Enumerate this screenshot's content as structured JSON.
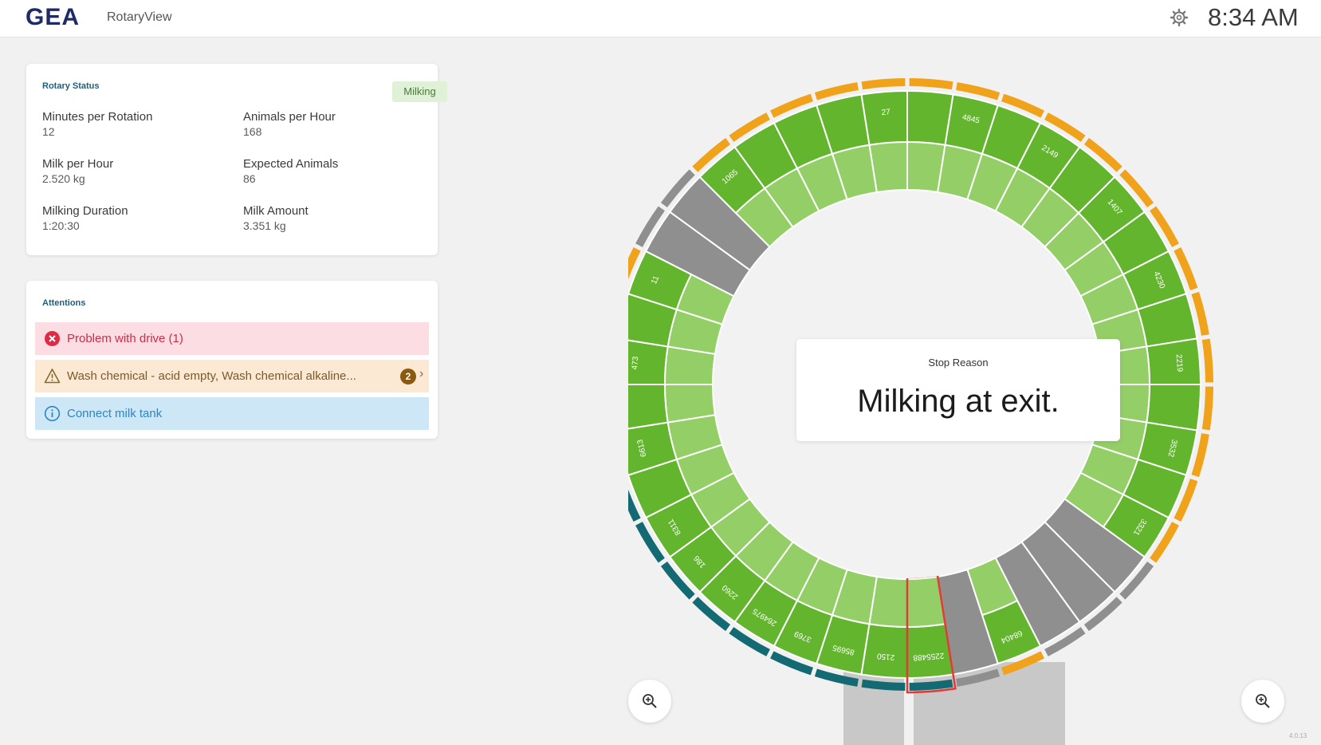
{
  "header": {
    "logo": "GEA",
    "app_name": "RotaryView",
    "settings_icon": "gear-icon",
    "time": "8:34 AM"
  },
  "rotary_status": {
    "title": "Rotary Status",
    "state": "Milking",
    "stats": [
      {
        "label": "Minutes per Rotation",
        "value": "12"
      },
      {
        "label": "Animals per Hour",
        "value": "168"
      },
      {
        "label": "Milk per Hour",
        "value": "2.520 kg"
      },
      {
        "label": "Expected Animals",
        "value": "86"
      },
      {
        "label": "Milking Duration",
        "value": "1:20:30"
      },
      {
        "label": "Milk Amount",
        "value": "3.351 kg"
      }
    ]
  },
  "attentions": {
    "title": "Attentions",
    "items": [
      {
        "type": "error",
        "icon": "error-circle-icon",
        "text": "Problem with drive (1)"
      },
      {
        "type": "warning",
        "icon": "warning-triangle-icon",
        "text": "Wash chemical - acid empty, Wash chemical alkaline...",
        "count": "2",
        "chevron": "chevron-right-icon"
      },
      {
        "type": "info",
        "icon": "info-circle-icon",
        "text": "Connect milk tank"
      }
    ]
  },
  "rotary": {
    "stall_count": 40,
    "stop_reason_label": "Stop Reason",
    "stop_reason": "Milking at exit.",
    "colors": {
      "green_dark": "#62b52d",
      "green_light": "#93cf66",
      "grey": "#8f8f8f",
      "grey_dark": "#7a7a7a",
      "orange": "#f0a21a",
      "teal": "#146a72",
      "divider": "#ffffff",
      "stall_number": "#e1574d",
      "selected": "#e53935"
    },
    "stalls": [
      {
        "state": "milking",
        "animal": "27",
        "outer": "orange"
      },
      {
        "state": "milking",
        "animal": "",
        "outer": "orange"
      },
      {
        "state": "milking",
        "animal": "4845",
        "outer": "orange"
      },
      {
        "state": "milking",
        "animal": "",
        "outer": "orange"
      },
      {
        "state": "milking",
        "animal": "2149",
        "outer": "orange"
      },
      {
        "state": "milking",
        "animal": "",
        "outer": "orange"
      },
      {
        "state": "milking",
        "animal": "1407",
        "outer": "orange"
      },
      {
        "state": "milking",
        "animal": "",
        "outer": "orange"
      },
      {
        "state": "milking",
        "animal": "4230",
        "outer": "orange"
      },
      {
        "state": "milking",
        "animal": "",
        "outer": "orange"
      },
      {
        "state": "milking",
        "animal": "2219",
        "outer": "orange"
      },
      {
        "state": "milking",
        "animal": "",
        "outer": "orange"
      },
      {
        "state": "milking",
        "animal": "3532",
        "outer": "orange"
      },
      {
        "state": "milking",
        "animal": "",
        "outer": "orange"
      },
      {
        "state": "milking",
        "animal": "3321",
        "outer": "orange"
      },
      {
        "state": "empty",
        "animal": "",
        "outer": "grey"
      },
      {
        "state": "empty",
        "animal": "",
        "outer": "grey"
      },
      {
        "state": "empty",
        "animal": "",
        "outer": "grey"
      },
      {
        "state": "milking",
        "animal": "68404",
        "outer": "orange"
      },
      {
        "state": "empty",
        "animal": "",
        "outer": "grey"
      },
      {
        "state": "milking",
        "animal": "2255488",
        "outer": "teal",
        "selected": true
      },
      {
        "state": "milking",
        "animal": "2150",
        "outer": "teal"
      },
      {
        "state": "milking",
        "animal": "85695",
        "outer": "teal"
      },
      {
        "state": "milking",
        "animal": "3769",
        "outer": "teal"
      },
      {
        "state": "milking",
        "animal": "264975",
        "outer": "teal"
      },
      {
        "state": "milking",
        "animal": "2260",
        "outer": "teal"
      },
      {
        "state": "milking",
        "animal": "186",
        "outer": "teal"
      },
      {
        "state": "milking",
        "animal": "8311",
        "outer": "teal"
      },
      {
        "state": "milking",
        "animal": "",
        "outer": "teal"
      },
      {
        "state": "milking",
        "animal": "6613",
        "outer": "orange"
      },
      {
        "state": "milking",
        "animal": "",
        "outer": "orange"
      },
      {
        "state": "milking",
        "animal": "473",
        "outer": "orange"
      },
      {
        "state": "milking",
        "animal": "",
        "outer": "orange"
      },
      {
        "state": "milking",
        "animal": "11",
        "outer": "orange"
      },
      {
        "state": "empty",
        "animal": "",
        "outer": "grey"
      },
      {
        "state": "empty",
        "animal": "",
        "outer": "grey"
      },
      {
        "state": "milking",
        "animal": "1065",
        "outer": "orange"
      },
      {
        "state": "milking",
        "animal": "",
        "outer": "orange"
      },
      {
        "state": "milking",
        "animal": "",
        "outer": "orange"
      },
      {
        "state": "milking",
        "animal": "",
        "outer": "orange"
      }
    ],
    "zoom_left_icon": "zoom-in-icon",
    "zoom_right_icon": "zoom-in-icon",
    "version": "4.0.13"
  }
}
